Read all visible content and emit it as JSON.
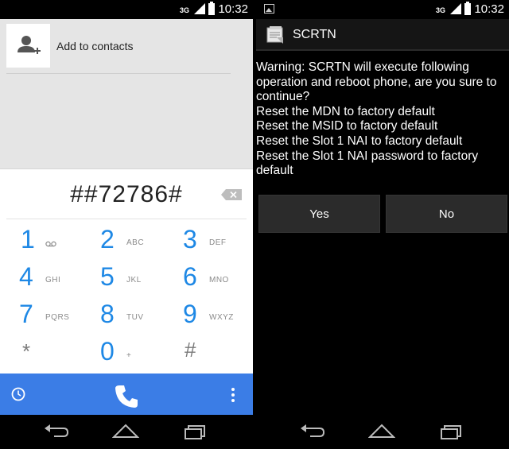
{
  "left_screen": {
    "status": {
      "network": "3G",
      "time": "10:32"
    },
    "contacts": {
      "add_label": "Add to contacts"
    },
    "dialpad": {
      "digits": "##72786#",
      "keys": [
        {
          "num": "1",
          "letters": ""
        },
        {
          "num": "2",
          "letters": "ABC"
        },
        {
          "num": "3",
          "letters": "DEF"
        },
        {
          "num": "4",
          "letters": "GHI"
        },
        {
          "num": "5",
          "letters": "JKL"
        },
        {
          "num": "6",
          "letters": "MNO"
        },
        {
          "num": "7",
          "letters": "PQRS"
        },
        {
          "num": "8",
          "letters": "TUV"
        },
        {
          "num": "9",
          "letters": "WXYZ"
        },
        {
          "num": "*",
          "letters": ""
        },
        {
          "num": "0",
          "letters": "+"
        },
        {
          "num": "#",
          "letters": ""
        }
      ]
    },
    "colors": {
      "accent": "#1e88e5",
      "action_bar": "#3b7de6"
    },
    "icons": [
      "add-contact-icon",
      "voicemail-icon",
      "backspace-icon",
      "history-icon",
      "call-icon",
      "overflow-menu-icon"
    ]
  },
  "right_screen": {
    "status": {
      "network": "3G",
      "time": "10:32"
    },
    "title": "SCRTN",
    "message_lines": [
      "Warning: SCRTN will execute following",
      "operation and reboot phone, are you sure to",
      "continue?",
      "Reset the MDN to factory default",
      "Reset the MSID to factory default",
      "Reset the Slot 1 NAI to factory default",
      "Reset the Slot 1 NAI password to factory",
      "default"
    ],
    "buttons": {
      "yes": "Yes",
      "no": "No"
    }
  },
  "navbar": {
    "icons": [
      "back-icon",
      "home-icon",
      "recents-icon"
    ]
  }
}
